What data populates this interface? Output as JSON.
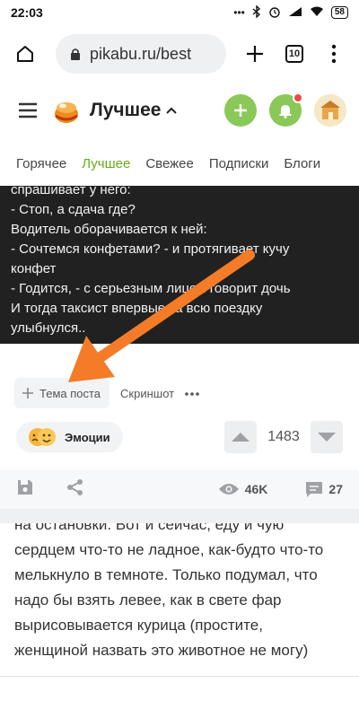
{
  "status_bar": {
    "time": "22:03",
    "battery": "58"
  },
  "browser": {
    "url": "pikabu.ru/best",
    "tab_count": "10"
  },
  "header": {
    "title": "Лучшее"
  },
  "tabs": [
    {
      "label": "Горячее",
      "active": false
    },
    {
      "label": "Лучшее",
      "active": true
    },
    {
      "label": "Свежее",
      "active": false
    },
    {
      "label": "Подписки",
      "active": false
    },
    {
      "label": "Блоги",
      "active": false
    }
  ],
  "post": {
    "text_lines": [
      "спрашивает у него:",
      "- Стоп, а сдача где?",
      "Водитель оборачивается к ней:",
      "- Сочтемся конфетами? - и протягивает кучу",
      "конфет",
      "- Годится, - с серьезным лицом говорит дочь",
      "И тогда таксист впервые за всю поездку",
      "улыбнулся.."
    ],
    "tag_button": "Тема поста",
    "screenshot_button": "Скриншот",
    "emotions_label": "Эмоции",
    "rating": "1483",
    "views": "46K",
    "comments": "27"
  },
  "next_post": {
    "text_lines": [
      "на остановки. Вот и сейчас, еду и чую",
      "сердцем что-то не ладное, как-будто что-то",
      "мелькнуло в темноте. Только подумал, что",
      "надо бы взять левее, как в свете фар",
      "вырисовывается курица (простите,",
      "женщиной назвать это животное не могу)"
    ]
  },
  "colors": {
    "accent_green": "#8ac858",
    "active_tab": "#6aaa1a",
    "arrow": "#f47c28",
    "notification": "#ee4a4a",
    "dark_bg": "#212121"
  }
}
